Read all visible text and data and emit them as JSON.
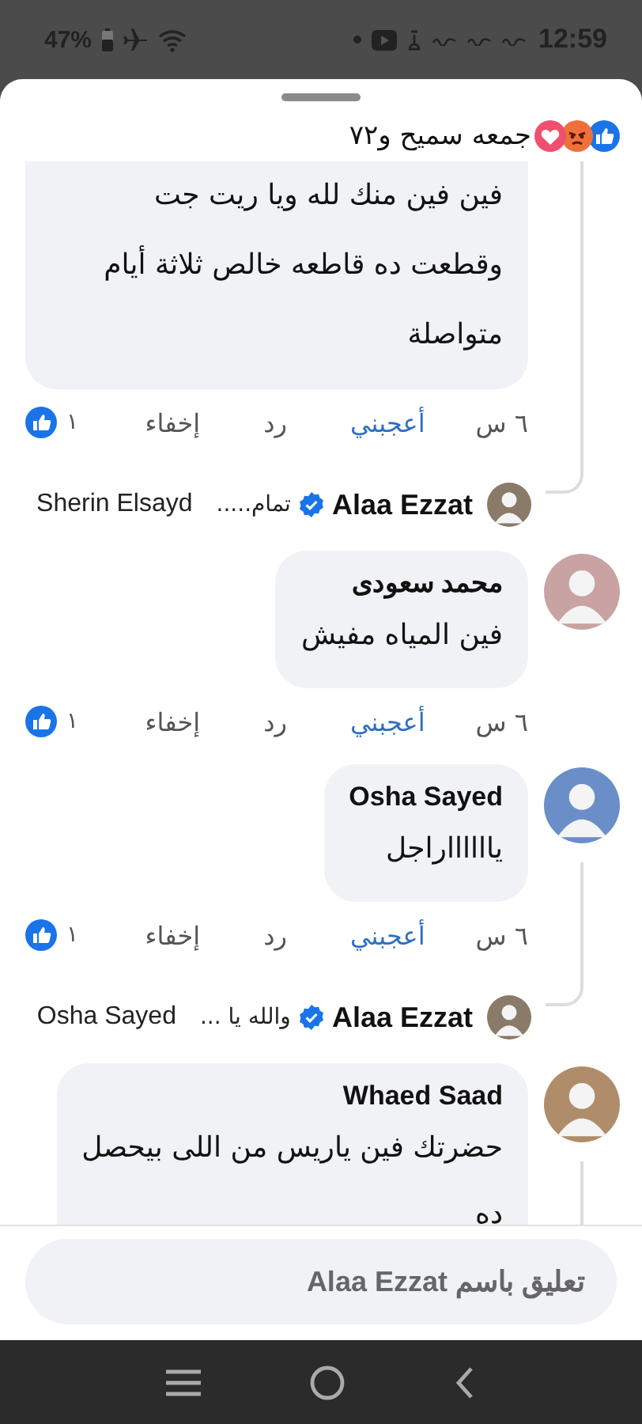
{
  "status_bar": {
    "battery": "47%",
    "time": "12:59"
  },
  "reactions_summary": {
    "text": "جمعه سميح و٧٢"
  },
  "comments": [
    {
      "cut_top": true,
      "text": "فين فين منك لله ويا ريت جت\nوقطعت ده قاطعه خالص ثلاثة أيام\nمتواصلة",
      "time": "٦ س",
      "like_label": "أعجبني",
      "reply_label": "رد",
      "hide_label": "إخفاء",
      "like_count": "١",
      "replies": [
        {
          "author": "Alaa Ezzat",
          "verified": true,
          "snippet": "تمام.....",
          "mention": "Sherin Elsayd"
        }
      ]
    },
    {
      "author": "محمد سعودى",
      "cut_top": false,
      "text": "فين المياه مفيش",
      "time": "٦ س",
      "like_label": "أعجبني",
      "reply_label": "رد",
      "hide_label": "إخفاء",
      "like_count": "١"
    },
    {
      "author": "Osha Sayed",
      "cut_top": false,
      "text": "يااااااراجل",
      "time": "٦ س",
      "like_label": "أعجبني",
      "reply_label": "رد",
      "hide_label": "إخفاء",
      "like_count": "١",
      "replies": [
        {
          "author": "Alaa Ezzat",
          "verified": true,
          "snippet": "والله يا ...",
          "mention": "Osha Sayed"
        }
      ]
    },
    {
      "author": "Whaed Saad",
      "cut_top": false,
      "text": "حضرتك فين ياريس من اللى بيحصل\nده",
      "more_replies": true
    }
  ],
  "comment_field": {
    "placeholder": "تعليق باسم Alaa Ezzat"
  }
}
